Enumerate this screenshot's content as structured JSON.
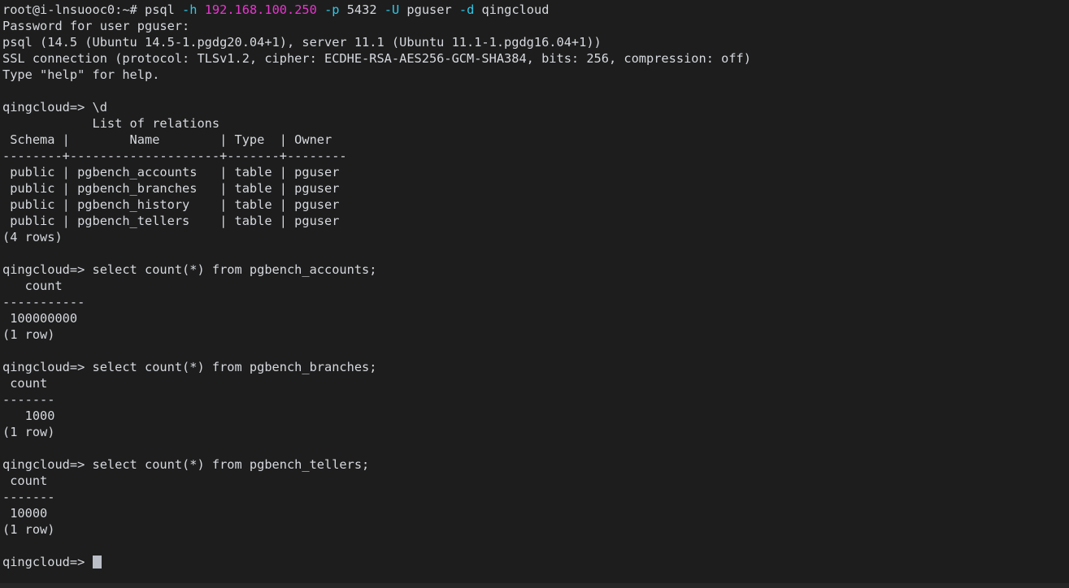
{
  "terminal": {
    "background_color": "#1d1d1d",
    "foreground_color": "#d6d9de",
    "flag_color": "#2ec9e8",
    "ip_color": "#e836d0",
    "cursor_color": "#b9bec7",
    "shell_prompt": "root@i-lnsuooc0:~#",
    "psql_prompt": "qingcloud=>"
  },
  "command": {
    "program": "psql",
    "flag_h": "-h",
    "host": "192.168.100.250",
    "flag_p": "-p",
    "port": "5432",
    "flag_U": "-U",
    "user": "pguser",
    "flag_d": "-d",
    "database": "qingcloud"
  },
  "lines": {
    "l01_prompt": "root@i-lnsuooc0:~# ",
    "l01_psql": "psql ",
    "l01_space": " ",
    "l02": "Password for user pguser:",
    "l03": "psql (14.5 (Ubuntu 14.5-1.pgdg20.04+1), server 11.1 (Ubuntu 11.1-1.pgdg16.04+1))",
    "l04": "SSL connection (protocol: TLSv1.2, cipher: ECDHE-RSA-AES256-GCM-SHA384, bits: 256, compression: off)",
    "l05": "Type \"help\" for help.",
    "l07": "qingcloud=> \\d",
    "l08": "            List of relations",
    "l09": " Schema |        Name        | Type  | Owner",
    "l10": "--------+--------------------+-------+--------",
    "l11": " public | pgbench_accounts   | table | pguser",
    "l12": " public | pgbench_branches   | table | pguser",
    "l13": " public | pgbench_history    | table | pguser",
    "l14": " public | pgbench_tellers    | table | pguser",
    "l15": "(4 rows)",
    "l17": "qingcloud=> select count(*) from pgbench_accounts;",
    "l18": "   count",
    "l19": "-----------",
    "l20": " 100000000",
    "l21": "(1 row)",
    "l23": "qingcloud=> select count(*) from pgbench_branches;",
    "l24": " count",
    "l25": "-------",
    "l26": "   1000",
    "l27": "(1 row)",
    "l29": "qingcloud=> select count(*) from pgbench_tellers;",
    "l30": " count",
    "l31": "-------",
    "l32": " 10000",
    "l33": "(1 row)",
    "l35_prompt": "qingcloud=> "
  },
  "relations_table": {
    "title": "List of relations",
    "headers": [
      "Schema",
      "Name",
      "Type",
      "Owner"
    ],
    "rows": [
      [
        "public",
        "pgbench_accounts",
        "table",
        "pguser"
      ],
      [
        "public",
        "pgbench_branches",
        "table",
        "pguser"
      ],
      [
        "public",
        "pgbench_history",
        "table",
        "pguser"
      ],
      [
        "public",
        "pgbench_tellers",
        "table",
        "pguser"
      ]
    ],
    "row_count_label": "(4 rows)"
  },
  "count_queries": [
    {
      "sql": "select count(*) from pgbench_accounts;",
      "column": "count",
      "value": "100000000",
      "row_count_label": "(1 row)"
    },
    {
      "sql": "select count(*) from pgbench_branches;",
      "column": "count",
      "value": "1000",
      "row_count_label": "(1 row)"
    },
    {
      "sql": "select count(*) from pgbench_tellers;",
      "column": "count",
      "value": "10000",
      "row_count_label": "(1 row)"
    }
  ]
}
